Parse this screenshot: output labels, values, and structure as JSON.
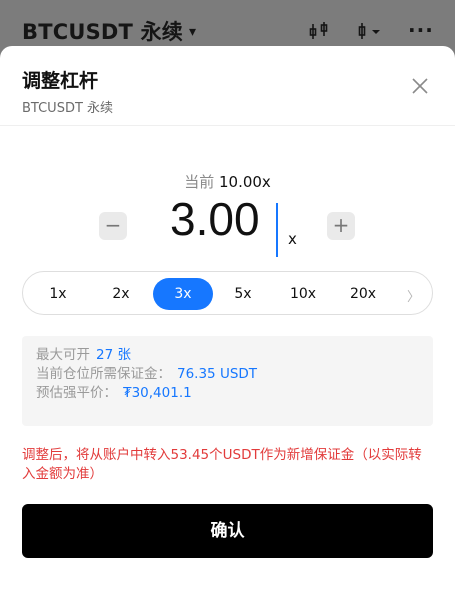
{
  "topbar": {
    "title": "BTCUSDT 永续",
    "caret": "▾",
    "more": "···"
  },
  "sheet": {
    "title": "调整杠杆",
    "subtitle": "BTCUSDT 永续",
    "close_icon": "close-icon"
  },
  "leverage": {
    "current_label": "当前",
    "current_value": "10.00x",
    "value": "3.00",
    "unit": "x",
    "minus": "−",
    "plus": "+"
  },
  "presets": {
    "items": [
      "1x",
      "2x",
      "3x",
      "5x",
      "10x",
      "20x"
    ],
    "selected": "3x",
    "chevron": "〉"
  },
  "info": {
    "max_label": "最大可开",
    "max_value": "27 张",
    "margin_label": "当前仓位所需保证金：",
    "margin_value": "76.35 USDT",
    "liq_label": "预估强平价：",
    "liq_value": "₮30,401.1"
  },
  "notice": "调整后，将从账户中转入53.45个USDT作为新增保证金（以实际转入金额为准）",
  "confirm_label": "确认",
  "colors": {
    "accent": "#1677ff",
    "warning": "#e23b3b",
    "button": "#000000"
  }
}
